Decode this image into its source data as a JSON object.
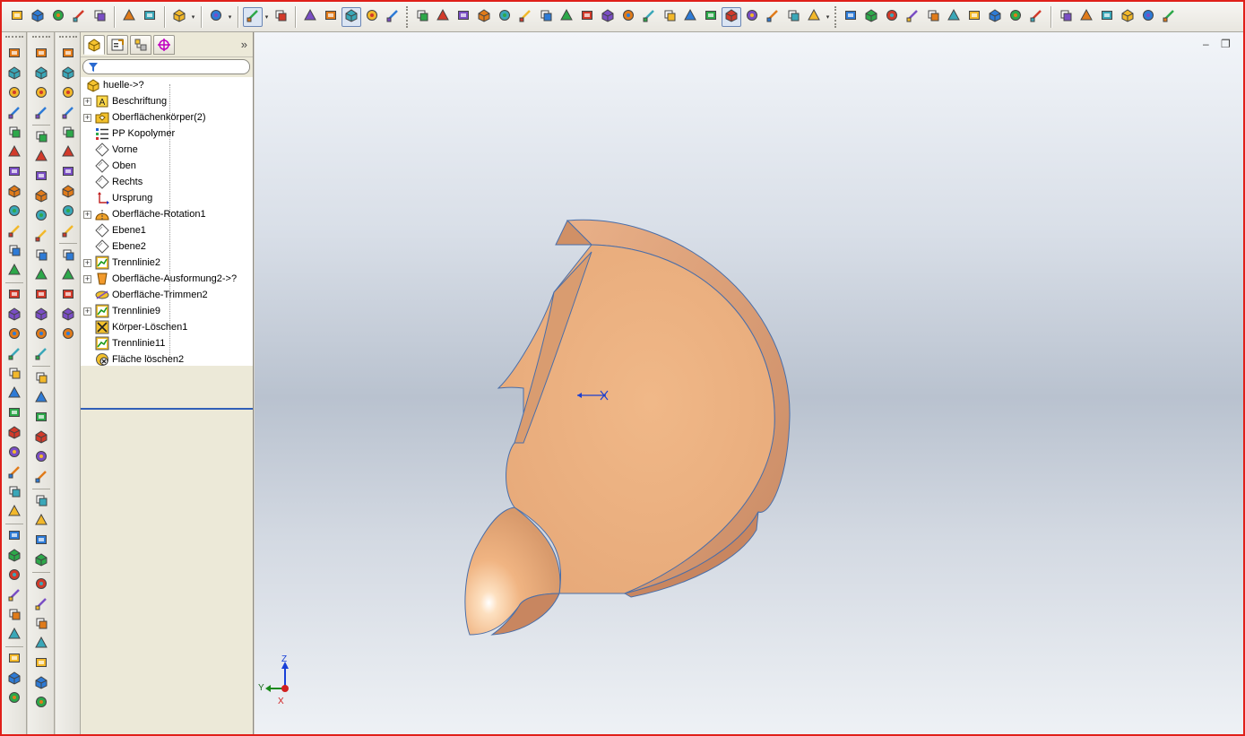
{
  "toolbar": {
    "groups": [
      [
        "new-document-icon",
        "open-folder-icon",
        "save-icon",
        "properties-icon",
        "rebuild-icon"
      ],
      [
        "print-icon",
        "print-preview-icon"
      ],
      [
        "undo-icon"
      ],
      [
        "redo-icon"
      ],
      [
        "select-arrow-icon",
        "traffic-light-icon"
      ],
      [
        "options-icon",
        "help-icon",
        "sketch-icon",
        "smart-dimension-icon",
        "edit-sketch-icon"
      ],
      [
        "appearance-icon",
        "color-wheel-icon",
        "view-front-icon",
        "view-back-icon",
        "view-left-icon",
        "view-right-icon",
        "view-top-icon",
        "view-bottom-icon",
        "view-iso-icon",
        "normal-to-icon",
        "reference-axis-icon",
        "section-view-icon",
        "wireframe-icon",
        "hidden-lines-icon",
        "hidden-removed-icon",
        "shaded-edges-icon",
        "shaded-icon",
        "shadow-icon",
        "realview-icon",
        "perspective-icon"
      ],
      [
        "surface-planar-icon",
        "surface-offset-icon",
        "surface-extend-icon",
        "surface-knit-icon",
        "surface-fill-icon",
        "surface-cut-icon",
        "surface-trim-icon",
        "surface-untrim-icon",
        "surface-ruled-icon",
        "surface-thicken-icon"
      ],
      [
        "rendering-icon",
        "photoworks-icon",
        "3d-view-icon",
        "toolbox-icon",
        "design-checker-icon",
        "zoom-window-icon"
      ]
    ]
  },
  "panel": {
    "tabs": [
      "feature-manager-tab",
      "property-manager-tab",
      "configuration-manager-tab",
      "dimxpert-tab"
    ],
    "collapse_glyph": "»",
    "root_label": "huelle->?",
    "items": [
      {
        "label": "Beschriftung",
        "icon": "annotation-icon",
        "expandable": true
      },
      {
        "label": "Oberflächenkörper(2)",
        "icon": "surface-bodies-icon",
        "expandable": true
      },
      {
        "label": "PP Kopolymer",
        "icon": "material-icon",
        "expandable": false
      },
      {
        "label": "Vorne",
        "icon": "plane-icon",
        "expandable": false
      },
      {
        "label": "Oben",
        "icon": "plane-icon",
        "expandable": false
      },
      {
        "label": "Rechts",
        "icon": "plane-icon",
        "expandable": false
      },
      {
        "label": "Ursprung",
        "icon": "origin-icon",
        "expandable": false
      },
      {
        "label": "Oberfläche-Rotation1",
        "icon": "surface-revolve-icon",
        "expandable": true
      },
      {
        "label": "Ebene1",
        "icon": "plane-icon",
        "expandable": false
      },
      {
        "label": "Ebene2",
        "icon": "plane-icon",
        "expandable": false
      },
      {
        "label": "Trennlinie2",
        "icon": "split-line-icon",
        "expandable": true
      },
      {
        "label": "Oberfläche-Ausformung2->?",
        "icon": "surface-loft-icon",
        "expandable": true
      },
      {
        "label": "Oberfläche-Trimmen2",
        "icon": "surface-trim-icon",
        "expandable": false
      },
      {
        "label": "Trennlinie9",
        "icon": "split-line-icon",
        "expandable": true
      },
      {
        "label": "Körper-Löschen1",
        "icon": "delete-body-icon",
        "expandable": false
      },
      {
        "label": "Trennlinie11",
        "icon": "split-line-icon",
        "expandable": false
      },
      {
        "label": "Fläche löschen2",
        "icon": "delete-face-icon",
        "expandable": false
      }
    ]
  },
  "triad": {
    "z": "Z",
    "y": "Y",
    "x": "X"
  },
  "viewport": {
    "minimize": "–",
    "restore": "❐"
  }
}
